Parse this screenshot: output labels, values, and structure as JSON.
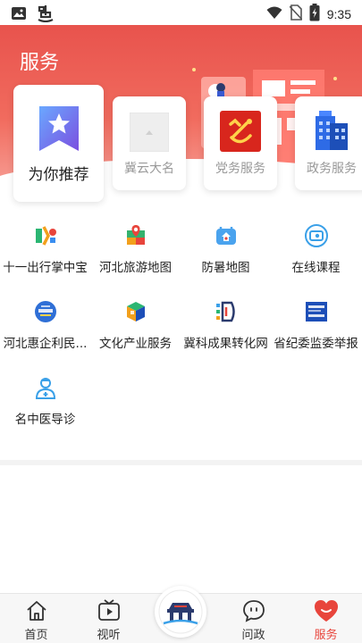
{
  "status_bar": {
    "time": "9:35",
    "left_icons": [
      "image-icon",
      "bug-icon"
    ],
    "right_icons": [
      "wifi-icon",
      "no-sim-icon",
      "battery-icon"
    ]
  },
  "header": {
    "title": "服务",
    "bg_color": "#e8534d"
  },
  "featured": [
    {
      "label": "为你推荐",
      "icon": "star-bookmark-icon"
    },
    {
      "label": "冀云大名",
      "icon": "image-placeholder-icon"
    },
    {
      "label": "党务服务",
      "icon": "party-emblem-icon"
    },
    {
      "label": "政务服务",
      "icon": "government-building-icon"
    }
  ],
  "services": [
    {
      "label": "十一出行掌中宝",
      "icon": "travel-app-icon"
    },
    {
      "label": "河北旅游地图",
      "icon": "travel-map-icon"
    },
    {
      "label": "防暑地图",
      "icon": "heat-map-icon"
    },
    {
      "label": "在线课程",
      "icon": "online-course-icon"
    },
    {
      "label": "河北惠企利民...",
      "icon": "policy-app-icon"
    },
    {
      "label": "文化产业服务",
      "icon": "culture-cube-icon"
    },
    {
      "label": "冀科成果转化网",
      "icon": "science-network-icon"
    },
    {
      "label": "省纪委监委举报",
      "icon": "report-app-icon"
    },
    {
      "label": "名中医导诊",
      "icon": "doctor-icon"
    }
  ],
  "bottom_nav": [
    {
      "label": "首页",
      "icon": "home-icon",
      "active": false
    },
    {
      "label": "视听",
      "icon": "tv-play-icon",
      "active": false
    },
    {
      "label": "",
      "icon": "center-logo-icon",
      "active": false
    },
    {
      "label": "问政",
      "icon": "chat-bubble-icon",
      "active": false
    },
    {
      "label": "服务",
      "icon": "heart-icon",
      "active": true
    }
  ],
  "colors": {
    "accent": "#e8453c",
    "header_gradient_top": "#e8534d",
    "header_gradient_bottom": "#f7a39a"
  }
}
